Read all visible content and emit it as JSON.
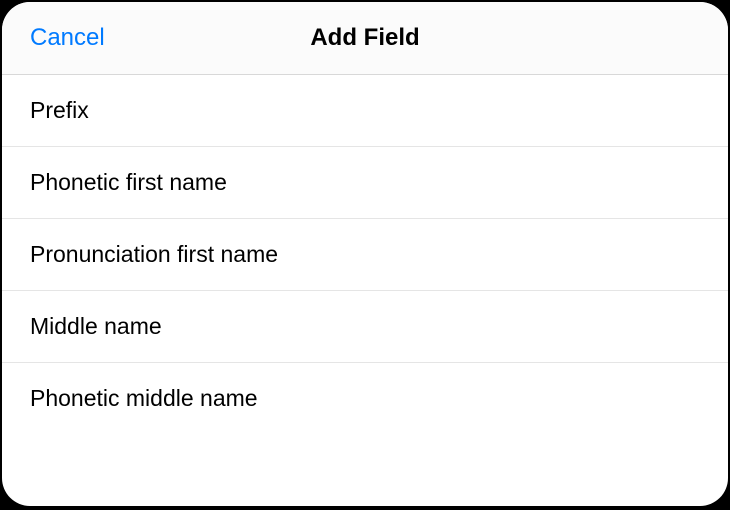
{
  "header": {
    "cancel_label": "Cancel",
    "title": "Add Field"
  },
  "fields": [
    {
      "label": "Prefix"
    },
    {
      "label": "Phonetic first name"
    },
    {
      "label": "Pronunciation first name"
    },
    {
      "label": "Middle name"
    },
    {
      "label": "Phonetic middle name"
    }
  ]
}
